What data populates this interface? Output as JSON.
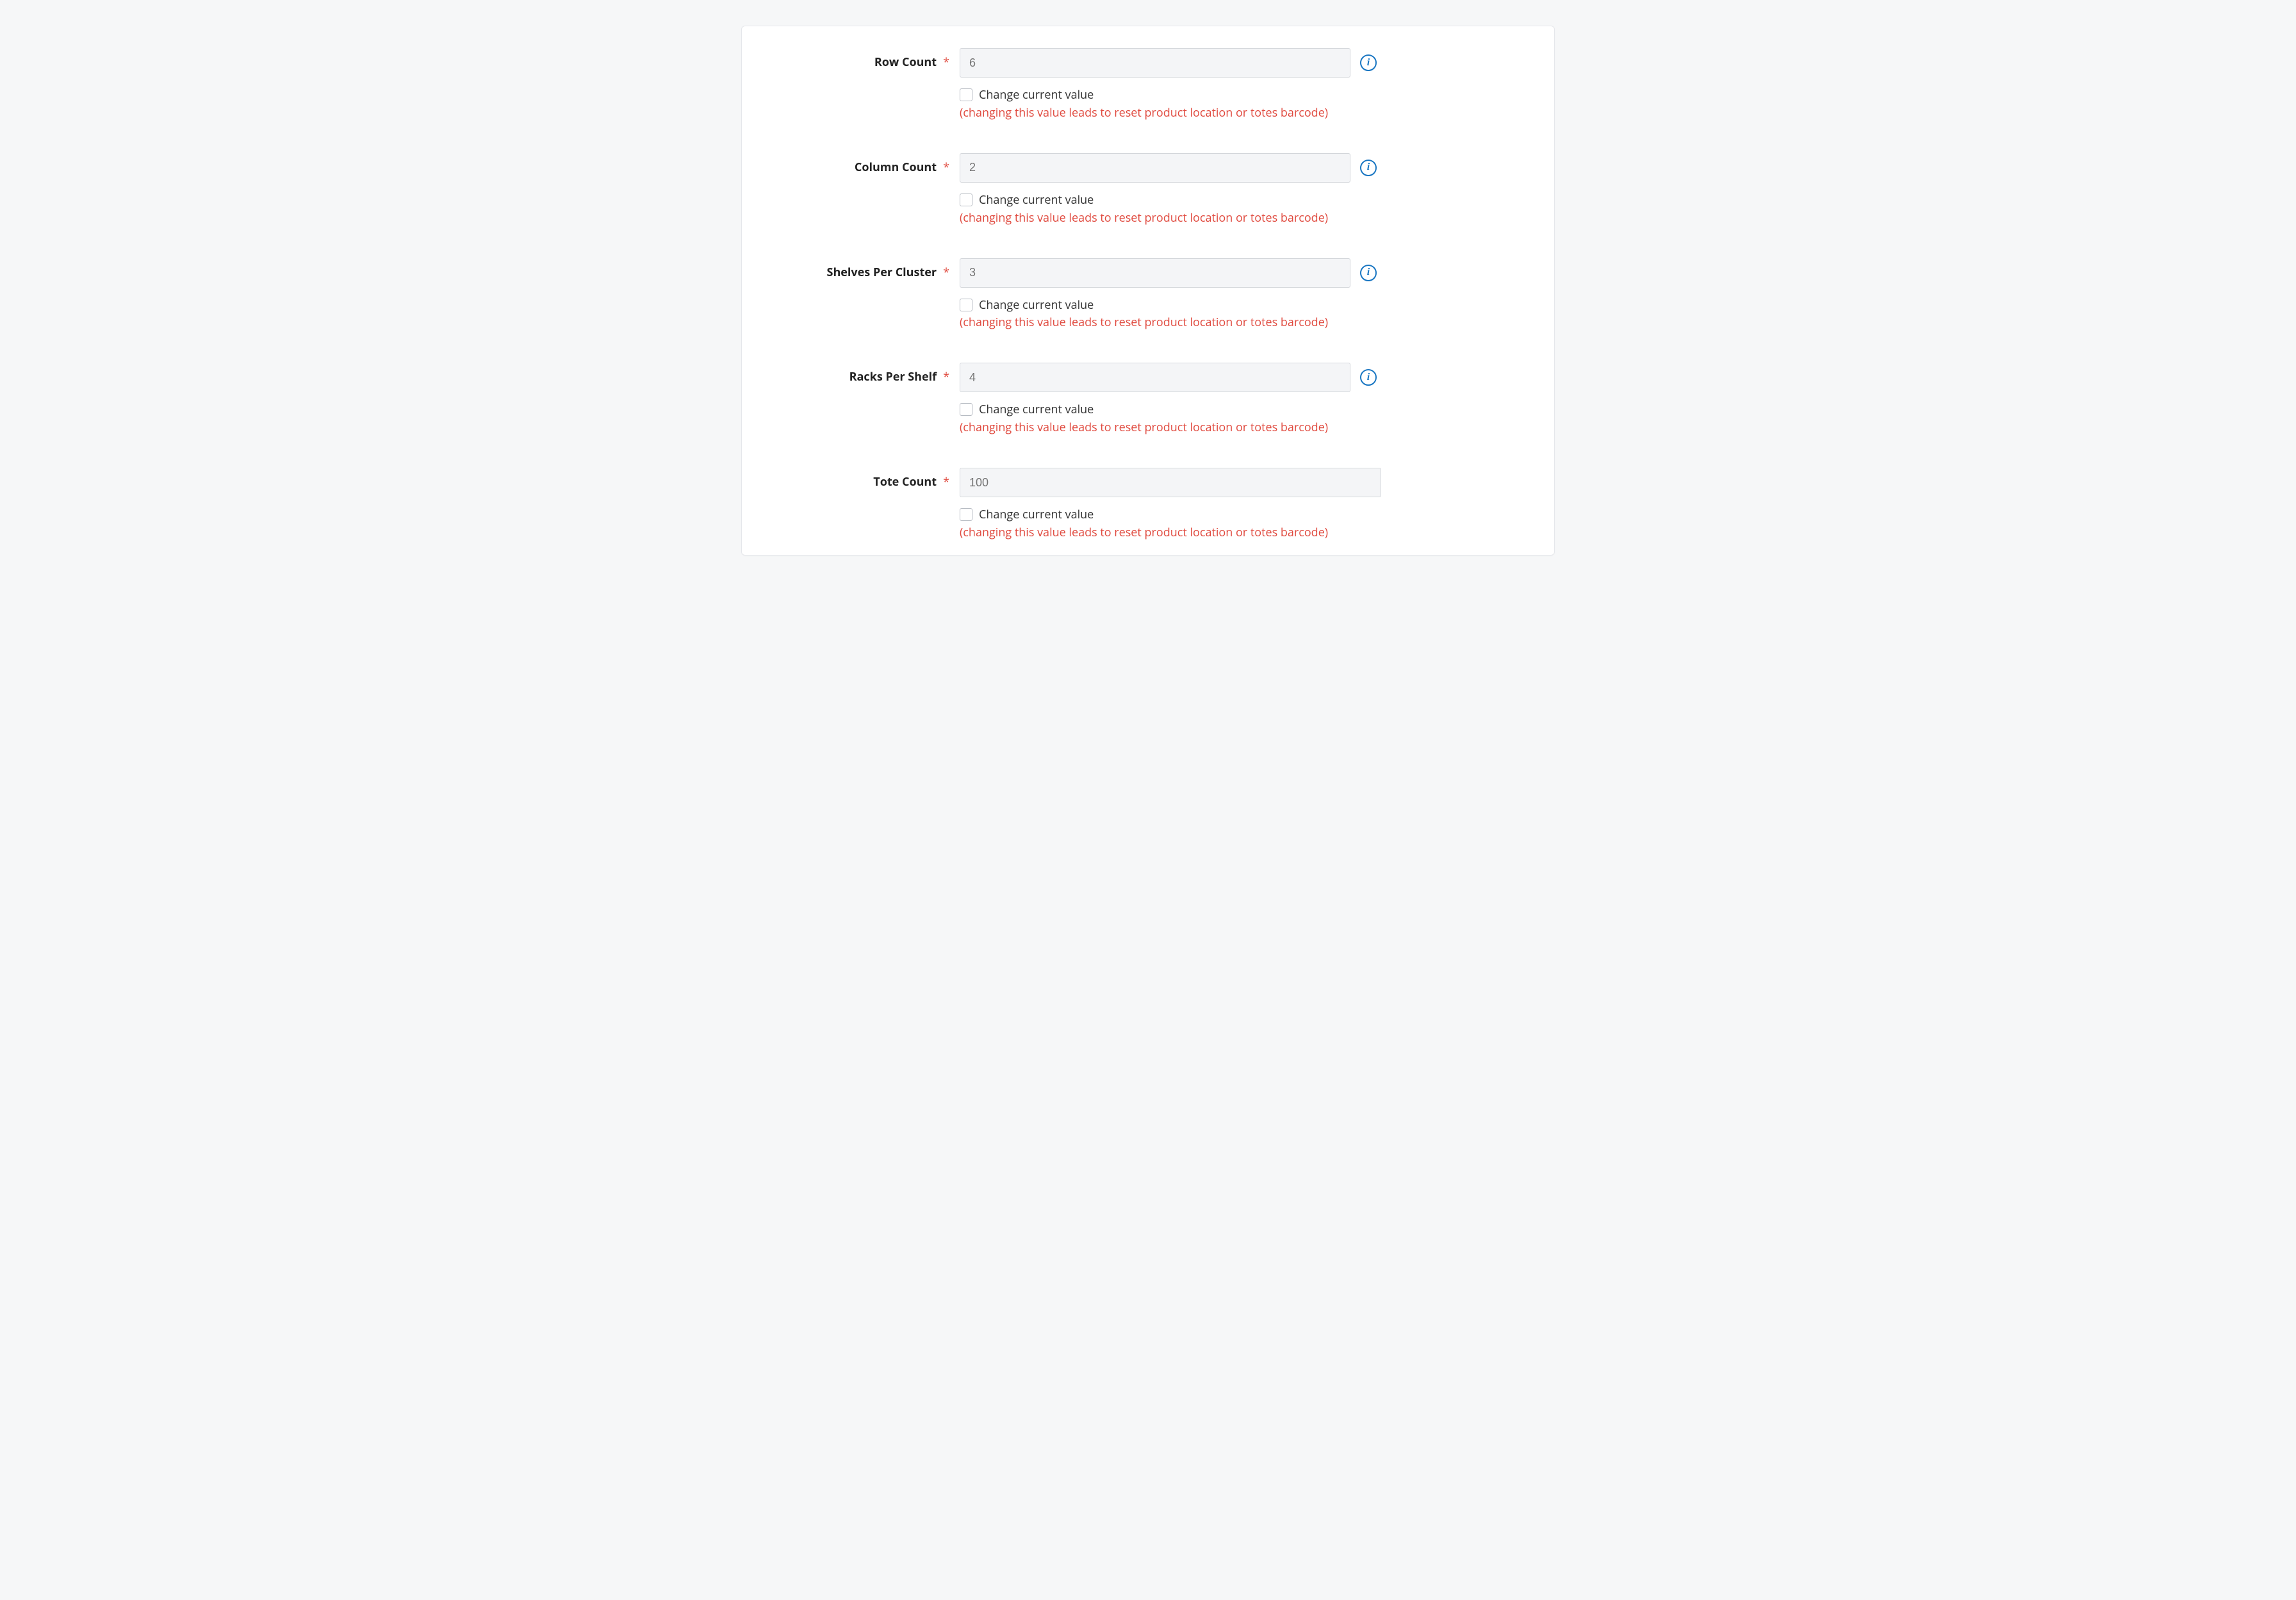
{
  "fields": [
    {
      "key": "row_count",
      "label": "Row Count",
      "required": true,
      "placeholder": "6",
      "has_info": true,
      "checkbox_label": "Change current value",
      "warning": "(changing this value leads to reset product location or totes barcode)"
    },
    {
      "key": "column_count",
      "label": "Column Count",
      "required": true,
      "placeholder": "2",
      "has_info": true,
      "checkbox_label": "Change current value",
      "warning": "(changing this value leads to reset product location or totes barcode)"
    },
    {
      "key": "shelves_per_cluster",
      "label": "Shelves Per Cluster",
      "required": true,
      "placeholder": "3",
      "has_info": true,
      "checkbox_label": "Change current value",
      "warning": "(changing this value leads to reset product location or totes barcode)"
    },
    {
      "key": "racks_per_shelf",
      "label": "Racks Per Shelf",
      "required": true,
      "placeholder": "4",
      "has_info": true,
      "checkbox_label": "Change current value",
      "warning": "(changing this value leads to reset product location or totes barcode)"
    },
    {
      "key": "tote_count",
      "label": "Tote Count",
      "required": true,
      "placeholder": "100",
      "has_info": false,
      "checkbox_label": "Change current value",
      "warning": "(changing this value leads to reset product location or totes barcode)"
    }
  ]
}
